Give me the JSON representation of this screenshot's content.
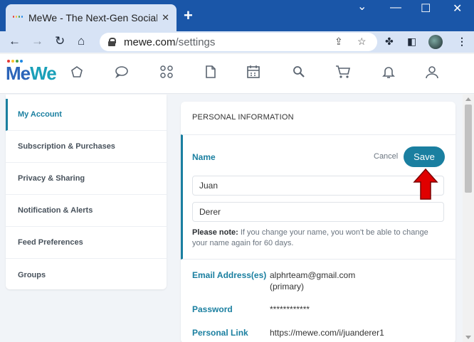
{
  "browser": {
    "tab_title": "MeWe - The Next-Gen Social Net",
    "tab_close": "✕",
    "new_tab": "+",
    "url_domain": "mewe.com",
    "url_path": "/settings",
    "win_minimize": "—",
    "win_maximize": "☐",
    "win_close": "✕"
  },
  "app": {
    "logo_me": "Me",
    "logo_we": "We"
  },
  "sidebar": {
    "items": [
      {
        "label": "My Account"
      },
      {
        "label": "Subscription & Purchases"
      },
      {
        "label": "Privacy & Sharing"
      },
      {
        "label": "Notification & Alerts"
      },
      {
        "label": "Feed Preferences"
      },
      {
        "label": "Groups"
      }
    ]
  },
  "panel": {
    "title": "PERSONAL INFORMATION",
    "name_label": "Name",
    "cancel_label": "Cancel",
    "save_label": "Save",
    "first_name": "Juan",
    "last_name": "Derer",
    "note_bold": "Please note:",
    "note_text": " If you change your name, you won't be able to change your name again for 60 days.",
    "email_label": "Email Address(es)",
    "email_value": "alphrteam@gmail.com",
    "email_sub": "(primary)",
    "password_label": "Password",
    "password_value": "************",
    "link_label": "Personal Link",
    "link_value": "https://mewe.com/i/juanderer1"
  },
  "colors": {
    "accent": "#1a7fa0",
    "chrome_blue": "#1a56a8",
    "annotation_arrow": "#e00000"
  }
}
